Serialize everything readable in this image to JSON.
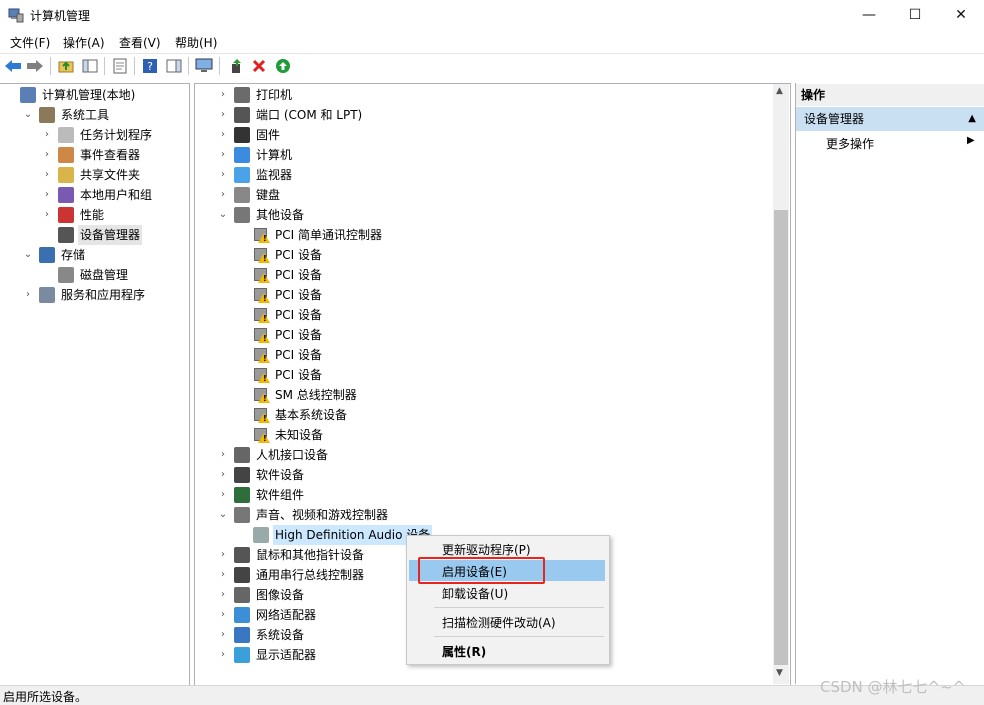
{
  "window": {
    "title": "计算机管理",
    "minimize": "—",
    "maximize": "☐",
    "close": "✕"
  },
  "menu": [
    "文件(F)",
    "操作(A)",
    "查看(V)",
    "帮助(H)"
  ],
  "toolbar": {
    "icons": [
      "back-arrow-icon",
      "forward-arrow-icon",
      "up-folder-icon",
      "show-hide-console-tree-icon",
      "properties-icon",
      "help-icon",
      "show-hide-action-pane-icon",
      "computer-monitor-icon",
      "update-driver-icon",
      "uninstall-icon",
      "enable-device-icon"
    ]
  },
  "left_tree": [
    {
      "label": "计算机管理(本地)",
      "chevron": "",
      "indent": 0,
      "icon": "computer-management-icon"
    },
    {
      "label": "系统工具",
      "chevron": "⌄",
      "indent": 1,
      "icon": "tools-icon"
    },
    {
      "label": "任务计划程序",
      "chevron": "›",
      "indent": 2,
      "icon": "clock-icon"
    },
    {
      "label": "事件查看器",
      "chevron": "›",
      "indent": 2,
      "icon": "event-viewer-icon"
    },
    {
      "label": "共享文件夹",
      "chevron": "›",
      "indent": 2,
      "icon": "shared-folder-icon"
    },
    {
      "label": "本地用户和组",
      "chevron": "›",
      "indent": 2,
      "icon": "users-icon"
    },
    {
      "label": "性能",
      "chevron": "›",
      "indent": 2,
      "icon": "performance-icon"
    },
    {
      "label": "设备管理器",
      "chevron": "",
      "indent": 2,
      "icon": "device-manager-icon",
      "selected": true
    },
    {
      "label": "存储",
      "chevron": "⌄",
      "indent": 1,
      "icon": "storage-icon"
    },
    {
      "label": "磁盘管理",
      "chevron": "",
      "indent": 2,
      "icon": "disk-icon"
    },
    {
      "label": "服务和应用程序",
      "chevron": "›",
      "indent": 1,
      "icon": "services-icon"
    }
  ],
  "device_tree": [
    {
      "label": "打印机",
      "chevron": "›",
      "indent": 0,
      "icon": "printer-icon"
    },
    {
      "label": "端口 (COM 和 LPT)",
      "chevron": "›",
      "indent": 0,
      "icon": "port-icon"
    },
    {
      "label": "固件",
      "chevron": "›",
      "indent": 0,
      "icon": "firmware-icon"
    },
    {
      "label": "计算机",
      "chevron": "›",
      "indent": 0,
      "icon": "computer-icon"
    },
    {
      "label": "监视器",
      "chevron": "›",
      "indent": 0,
      "icon": "monitor-icon"
    },
    {
      "label": "键盘",
      "chevron": "›",
      "indent": 0,
      "icon": "keyboard-icon"
    },
    {
      "label": "其他设备",
      "chevron": "⌄",
      "indent": 0,
      "icon": "other-devices-icon"
    },
    {
      "label": "PCI 简单通讯控制器",
      "chevron": "",
      "indent": 1,
      "icon": "warning-device-icon"
    },
    {
      "label": "PCI 设备",
      "chevron": "",
      "indent": 1,
      "icon": "warning-device-icon"
    },
    {
      "label": "PCI 设备",
      "chevron": "",
      "indent": 1,
      "icon": "warning-device-icon"
    },
    {
      "label": "PCI 设备",
      "chevron": "",
      "indent": 1,
      "icon": "warning-device-icon"
    },
    {
      "label": "PCI 设备",
      "chevron": "",
      "indent": 1,
      "icon": "warning-device-icon"
    },
    {
      "label": "PCI 设备",
      "chevron": "",
      "indent": 1,
      "icon": "warning-device-icon"
    },
    {
      "label": "PCI 设备",
      "chevron": "",
      "indent": 1,
      "icon": "warning-device-icon"
    },
    {
      "label": "PCI 设备",
      "chevron": "",
      "indent": 1,
      "icon": "warning-device-icon"
    },
    {
      "label": "SM 总线控制器",
      "chevron": "",
      "indent": 1,
      "icon": "warning-device-icon"
    },
    {
      "label": "基本系统设备",
      "chevron": "",
      "indent": 1,
      "icon": "warning-device-icon"
    },
    {
      "label": "未知设备",
      "chevron": "",
      "indent": 1,
      "icon": "warning-device-icon"
    },
    {
      "label": "人机接口设备",
      "chevron": "›",
      "indent": 0,
      "icon": "hid-icon"
    },
    {
      "label": "软件设备",
      "chevron": "›",
      "indent": 0,
      "icon": "software-device-icon"
    },
    {
      "label": "软件组件",
      "chevron": "›",
      "indent": 0,
      "icon": "software-component-icon"
    },
    {
      "label": "声音、视频和游戏控制器",
      "chevron": "⌄",
      "indent": 0,
      "icon": "speaker-icon"
    },
    {
      "label": "High Definition Audio 设备",
      "chevron": "",
      "indent": 1,
      "icon": "audio-disabled-icon",
      "selected": true
    },
    {
      "label": "鼠标和其他指针设备",
      "chevron": "›",
      "indent": 0,
      "icon": "mouse-icon"
    },
    {
      "label": "通用串行总线控制器",
      "chevron": "›",
      "indent": 0,
      "icon": "usb-icon"
    },
    {
      "label": "图像设备",
      "chevron": "›",
      "indent": 0,
      "icon": "camera-icon"
    },
    {
      "label": "网络适配器",
      "chevron": "›",
      "indent": 0,
      "icon": "network-icon"
    },
    {
      "label": "系统设备",
      "chevron": "›",
      "indent": 0,
      "icon": "system-device-icon"
    },
    {
      "label": "显示适配器",
      "chevron": "›",
      "indent": 0,
      "icon": "display-adapter-icon"
    }
  ],
  "actions": {
    "header": "操作",
    "section": "设备管理器",
    "more": "更多操作"
  },
  "context_menu": {
    "update_driver": "更新驱动程序(P)",
    "enable": "启用设备(E)",
    "uninstall": "卸载设备(U)",
    "scan": "扫描检测硬件改动(A)",
    "properties": "属性(R)"
  },
  "status": "启用所选设备。",
  "watermark": "CSDN @林七七^~^"
}
